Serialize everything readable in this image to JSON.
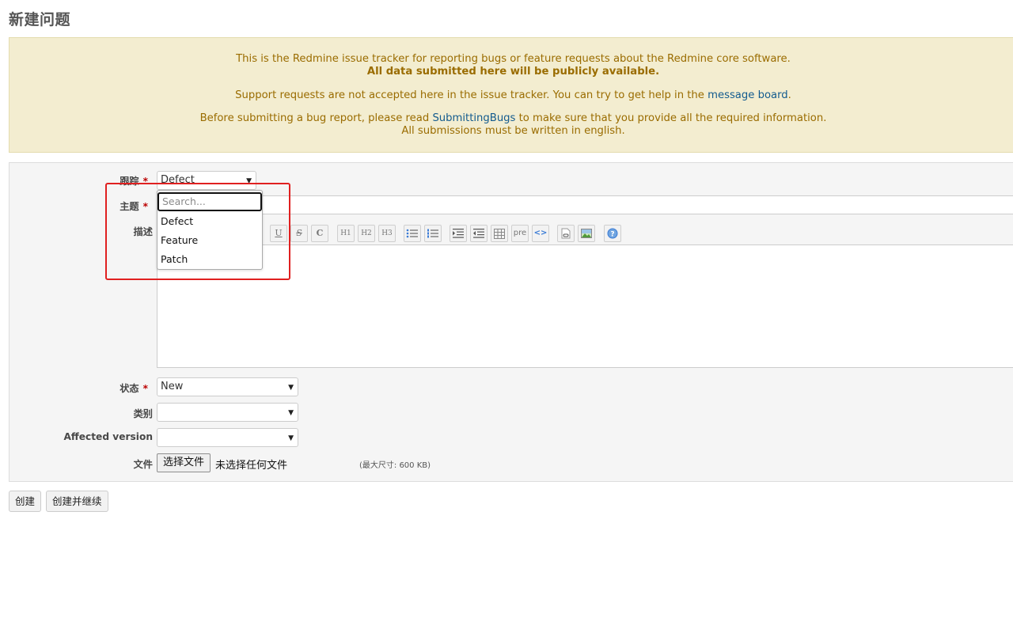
{
  "page": {
    "title": "新建问题"
  },
  "notice": {
    "line1": "This is the Redmine issue tracker for reporting bugs or feature requests about the Redmine core software.",
    "line2": "All data submitted here will be publicly available.",
    "line3_before": "Support requests are not accepted here in the issue tracker. You can try to get help in the ",
    "line3_link": "message board",
    "line3_after": ".",
    "line4_before": "Before submitting a bug report, please read ",
    "line4_link": "SubmittingBugs",
    "line4_after": " to make sure that you provide all the required information.",
    "line5": "All submissions must be written in english."
  },
  "form": {
    "tracker": {
      "label": "跟踪",
      "required": "*",
      "value": "Defect"
    },
    "subject": {
      "label": "主题",
      "required": "*",
      "value": ""
    },
    "description": {
      "label": "描述",
      "value": ""
    },
    "status": {
      "label": "状态",
      "required": "*",
      "value": "New"
    },
    "category": {
      "label": "类别",
      "value": ""
    },
    "version": {
      "label": "Affected version",
      "value": ""
    },
    "file": {
      "label": "文件",
      "button": "选择文件",
      "none_text": "未选择任何文件",
      "max_size": "(最大尺寸: 600 KB)"
    }
  },
  "toolbar": {
    "buttons": [
      "U",
      "S",
      "C",
      "H1",
      "H2",
      "H3",
      "ul",
      "ol",
      "indent",
      "outdent",
      "table",
      "pre",
      "code",
      "link",
      "image",
      "help"
    ],
    "pre_label": "pre"
  },
  "dropdown": {
    "search_placeholder": "Search...",
    "options": [
      "Defect",
      "Feature",
      "Patch"
    ]
  },
  "actions": {
    "create": "创建",
    "create_continue": "创建并继续"
  },
  "colors": {
    "notice_bg": "#f3edd0",
    "notice_text": "#9a6c00",
    "link": "#135b8e",
    "required": "#bb0000",
    "highlight": "#e02020"
  }
}
